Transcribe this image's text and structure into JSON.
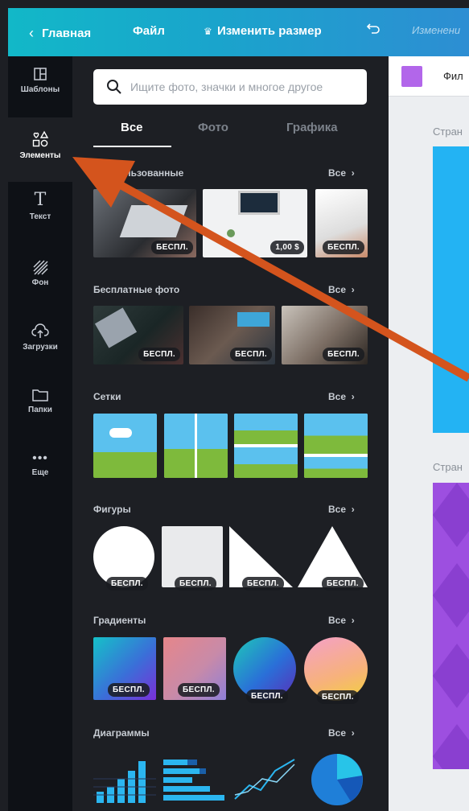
{
  "topbar": {
    "back_label": "Главная",
    "file_label": "Файл",
    "resize_label": "Изменить размер",
    "status_label": "Изменени"
  },
  "rail": {
    "items": [
      {
        "label": "Шаблоны",
        "icon": "templates-icon"
      },
      {
        "label": "Элементы",
        "icon": "elements-icon",
        "active": true
      },
      {
        "label": "Текст",
        "icon": "text-icon"
      },
      {
        "label": "Фон",
        "icon": "background-icon"
      },
      {
        "label": "Загрузки",
        "icon": "upload-icon"
      },
      {
        "label": "Папки",
        "icon": "folder-icon"
      },
      {
        "label": "Еще",
        "icon": "more-icon"
      }
    ]
  },
  "search": {
    "placeholder": "Ищите фото, значки и многое другое"
  },
  "tabs": [
    {
      "label": "Все",
      "active": true
    },
    {
      "label": "Фото"
    },
    {
      "label": "Графика"
    }
  ],
  "sections": {
    "recent": {
      "title": "Недавно использованные",
      "title_visible": "о использованные",
      "all": "Все",
      "badges": [
        "БЕСПЛ.",
        "1,00 $",
        "БЕСПЛ."
      ]
    },
    "free_photos": {
      "title": "Бесплатные фото",
      "all": "Все",
      "badges": [
        "БЕСПЛ.",
        "БЕСПЛ.",
        "БЕСПЛ."
      ]
    },
    "grids": {
      "title": "Сетки",
      "all": "Все"
    },
    "shapes": {
      "title": "Фигуры",
      "all": "Все",
      "badges": [
        "БЕСПЛ.",
        "БЕСПЛ.",
        "БЕСПЛ.",
        "БЕСПЛ."
      ]
    },
    "gradients": {
      "title": "Градиенты",
      "all": "Все",
      "badges": [
        "БЕСПЛ.",
        "БЕСПЛ.",
        "БЕСПЛ.",
        "БЕСПЛ."
      ]
    },
    "charts": {
      "title": "Диаграммы",
      "all": "Все"
    }
  },
  "canvas": {
    "toolbar_text": "Фил",
    "fill_color": "#b266ea",
    "page1_label": "Стран",
    "page2_label": "Стран",
    "page1_color": "#23b3f3",
    "page2_color": "#9d4fe0"
  },
  "colors": {
    "accent_arrow": "#d4541d",
    "topbar_start": "#12b8c8",
    "topbar_end": "#2d8ed3"
  }
}
